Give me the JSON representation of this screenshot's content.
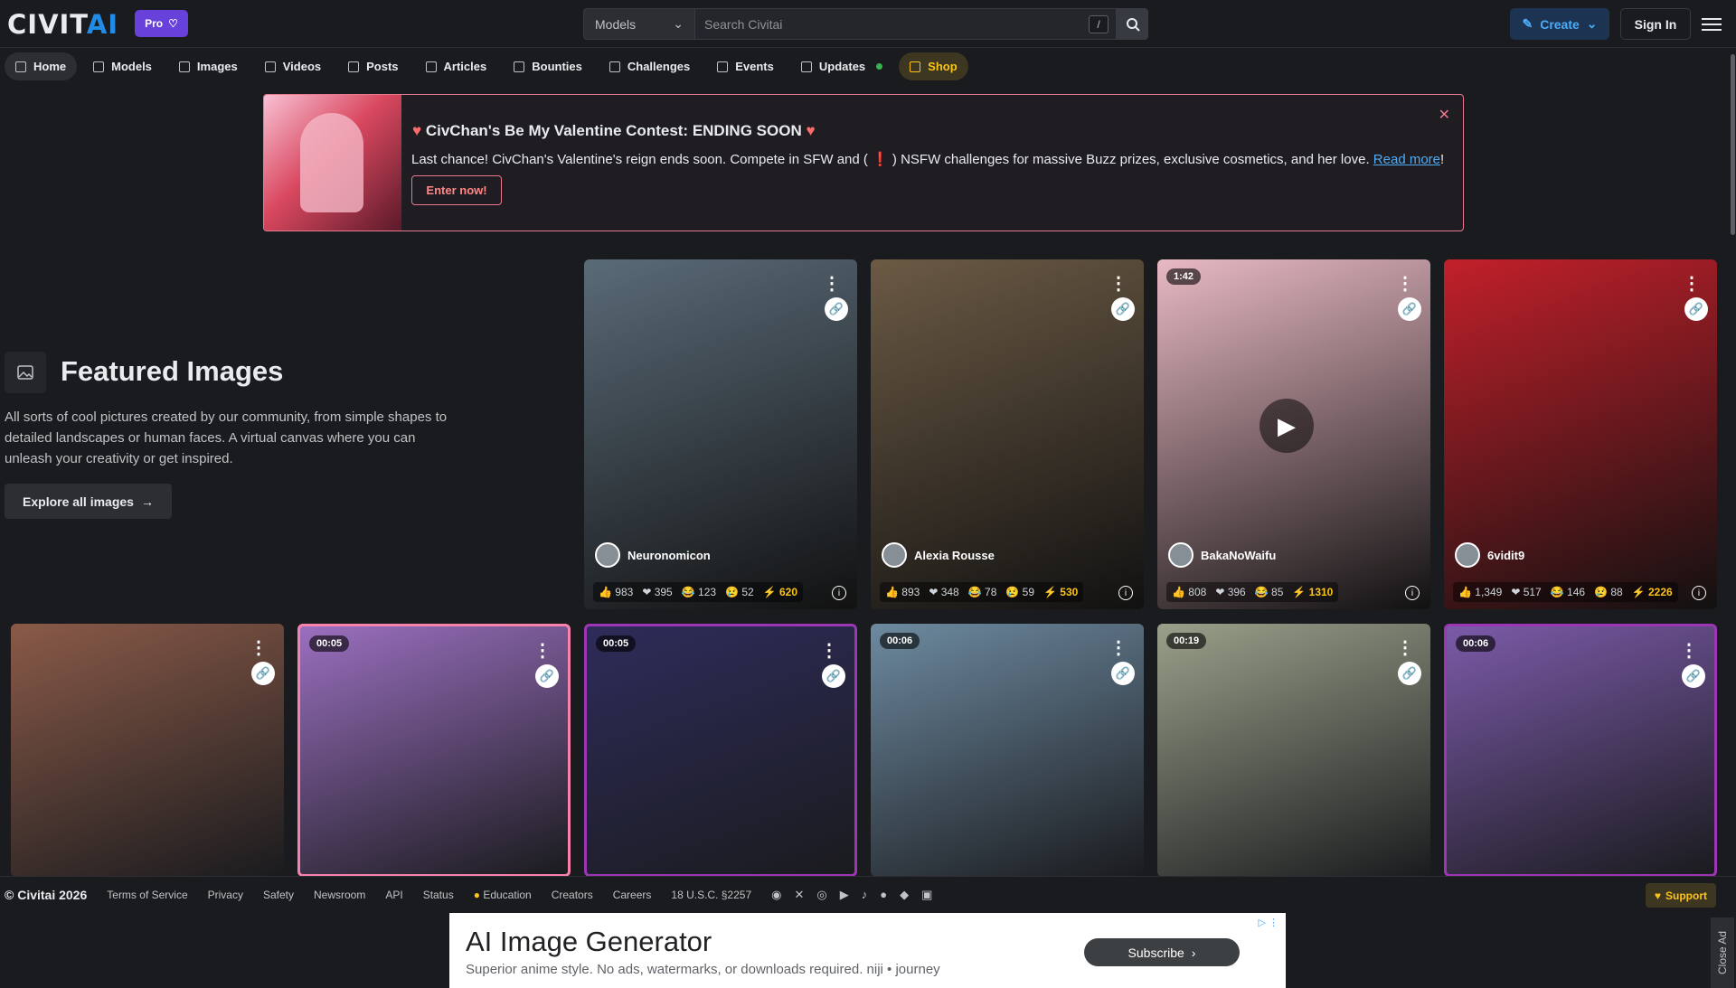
{
  "header": {
    "logo_main": "CIVIT",
    "logo_accent": "AI",
    "pro_label": "Pro",
    "search_select": "Models",
    "search_placeholder": "Search Civitai",
    "search_shortcut": "/",
    "create_label": "Create",
    "signin_label": "Sign In"
  },
  "nav": {
    "items": [
      {
        "label": "Home",
        "icon": "home-icon"
      },
      {
        "label": "Models",
        "icon": "grid-icon"
      },
      {
        "label": "Images",
        "icon": "photo-icon"
      },
      {
        "label": "Videos",
        "icon": "video-icon"
      },
      {
        "label": "Posts",
        "icon": "posts-icon"
      },
      {
        "label": "Articles",
        "icon": "article-icon"
      },
      {
        "label": "Bounties",
        "icon": "bounty-icon"
      },
      {
        "label": "Challenges",
        "icon": "trophy-icon"
      },
      {
        "label": "Events",
        "icon": "calendar-icon"
      },
      {
        "label": "Updates",
        "icon": "updates-icon"
      },
      {
        "label": "Shop",
        "icon": "shop-icon"
      }
    ]
  },
  "banner": {
    "title": "CivChan's Be My Valentine Contest: ENDING SOON",
    "text_before": "Last chance! CivChan's Valentine's reign ends soon. Compete in SFW and (",
    "text_mark": "❗",
    "text_after": ") NSFW challenges for massive Buzz prizes, exclusive cosmetics, and her love.",
    "link": "Read more",
    "link_suffix": "!",
    "button": "Enter now!"
  },
  "featured": {
    "title": "Featured Images",
    "description": "All sorts of cool pictures created by our community, from simple shapes to detailed landscapes or human faces. A virtual canvas where you can unleash your creativity or get inspired.",
    "explore_label": "Explore all images"
  },
  "cards_row1": [
    {
      "user": "Neuronomicon",
      "likes": "983",
      "hearts": "395",
      "laughs": "123",
      "cries": "52",
      "buzz": "620",
      "bg": "#5a6b78"
    },
    {
      "user": "Alexia Rousse",
      "likes": "893",
      "hearts": "348",
      "laughs": "78",
      "cries": "59",
      "buzz": "530",
      "bg": "#6b5a44"
    },
    {
      "user": "BakaNoWaifu",
      "duration": "1:42",
      "likes": "808",
      "hearts": "396",
      "laughs": "85",
      "cries": "",
      "buzz": "1310",
      "bg": "#e8b9c3"
    },
    {
      "user": "6vidit9",
      "likes": "1,349",
      "hearts": "517",
      "laughs": "146",
      "cries": "88",
      "buzz": "2226",
      "bg": "#c2202a"
    }
  ],
  "cards_row2": [
    {
      "duration": "",
      "bg": "#8a5a48"
    },
    {
      "duration": "00:05",
      "bg": "#9a6fbf"
    },
    {
      "duration": "00:05",
      "bg": "#2e2c5a"
    },
    {
      "duration": "00:06",
      "bg": "#6d8aa0"
    },
    {
      "duration": "00:19",
      "bg": "#9aa08a"
    },
    {
      "duration": "00:06",
      "bg": "#7b5aa8"
    }
  ],
  "footer": {
    "copyright": "© Civitai 2026",
    "links": [
      "Terms of Service",
      "Privacy",
      "Safety",
      "Newsroom",
      "API",
      "Status",
      "Education",
      "Creators",
      "Careers",
      "18 U.S.C. §2257"
    ],
    "support": "Support"
  },
  "ad": {
    "title": "AI Image Generator",
    "subtitle": "Superior anime style. No ads, watermarks, or downloads required. niji • journey",
    "button": "Subscribe",
    "close": "Close Ad"
  }
}
